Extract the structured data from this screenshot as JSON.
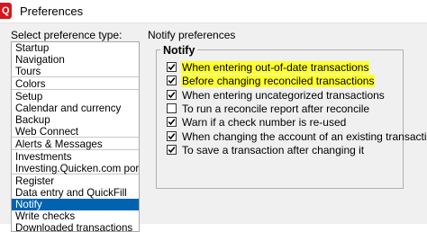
{
  "window": {
    "title": "Preferences",
    "icon": "quicken-q-icon",
    "icon_letter": "Q"
  },
  "left_panel": {
    "heading": "Select preference type:",
    "items": [
      {
        "label": "Startup"
      },
      {
        "label": "Navigation"
      },
      {
        "label": "Tours"
      },
      {
        "label": "Colors"
      },
      {
        "label": "Setup"
      },
      {
        "label": "Calendar and currency"
      },
      {
        "label": "Backup"
      },
      {
        "label": "Web Connect"
      },
      {
        "label": "Alerts & Messages"
      },
      {
        "label": "Investments"
      },
      {
        "label": "Investing.Quicken.com portfolio"
      },
      {
        "label": "Register"
      },
      {
        "label": "Data entry and QuickFill"
      },
      {
        "label": "Notify"
      },
      {
        "label": "Write checks"
      },
      {
        "label": "Downloaded transactions"
      }
    ],
    "selected": "Notify"
  },
  "right_panel": {
    "heading": "Notify preferences",
    "group_title": "Notify",
    "options": [
      {
        "label": "When entering out-of-date transactions",
        "checked": true,
        "highlighted": true
      },
      {
        "label": "Before changing reconciled transactions",
        "checked": true,
        "highlighted": true
      },
      {
        "label": "When entering uncategorized transactions",
        "checked": true,
        "highlighted": false
      },
      {
        "label": "To run a reconcile report after reconcile",
        "checked": false,
        "highlighted": false
      },
      {
        "label": "Warn if a check number is re-used",
        "checked": true,
        "highlighted": false
      },
      {
        "label": "When changing the account of an existing transaction",
        "checked": true,
        "highlighted": false
      },
      {
        "label": "To save a transaction after changing it",
        "checked": true,
        "highlighted": false
      }
    ]
  },
  "colors": {
    "selection": "#0063b1",
    "highlight": "#ffff2e",
    "brand": "#d6171d"
  }
}
